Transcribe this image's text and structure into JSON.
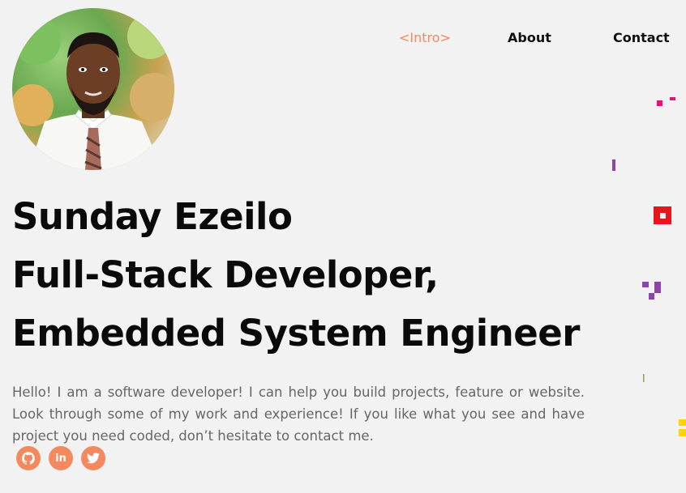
{
  "profile": {
    "name": "Sunday Ezeilo",
    "role_line_1": "Full-Stack Developer,",
    "role_line_2": "Embedded System Engineer",
    "intro": "Hello! I am a software developer! I can help you build projects, feature or website. Look through some of my work and experience! If you like what you see and have project you need coded, don’t hesitate to contact me."
  },
  "nav": {
    "items": [
      {
        "label": "<Intro>",
        "active": true
      },
      {
        "label": "About",
        "active": false
      },
      {
        "label": "Contact",
        "active": false
      }
    ]
  },
  "socials": {
    "icons": [
      "github-icon",
      "linkedin-icon",
      "twitter-icon"
    ],
    "linkedin_glyph": "in"
  },
  "colors": {
    "accent": "#f4895f",
    "background": "#f2f2f2",
    "heading": "#0a0a0a",
    "body_text": "#666666",
    "deco_pink": "#e0147a",
    "deco_purple": "#8e44ad",
    "deco_red": "#e8161c",
    "deco_yellow": "#ffd400",
    "deco_olive": "#9aa04a"
  }
}
